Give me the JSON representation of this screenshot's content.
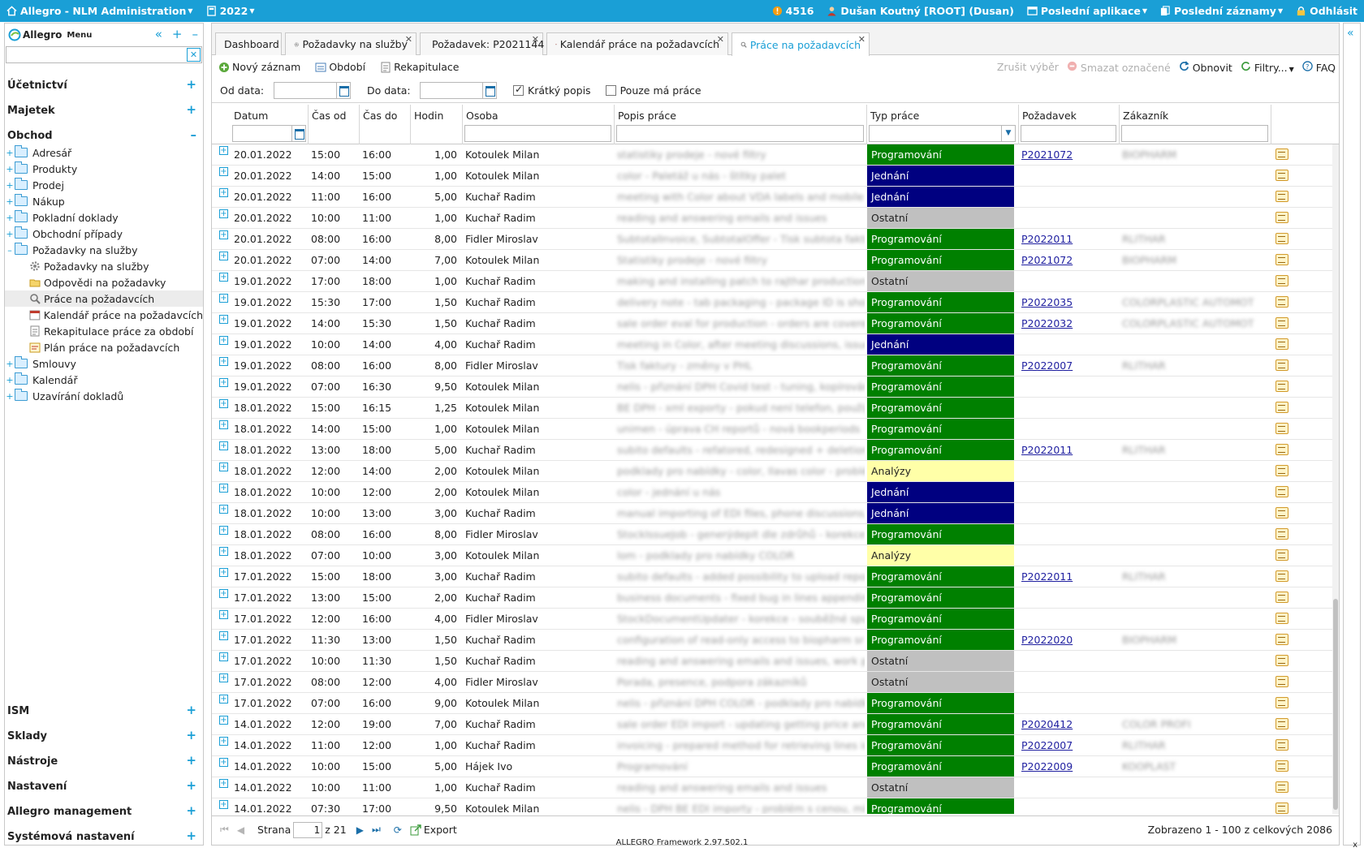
{
  "topbar": {
    "app_title": "Allegro - NLM Administration",
    "year": "2022",
    "count": "4516",
    "user": "Dušan Koutný [ROOT] (Dusan)",
    "recent_apps": "Poslední aplikace",
    "recent_records": "Poslední záznamy",
    "logout": "Odhlásit"
  },
  "sidebar": {
    "logo": "Allegro",
    "menu_label": "Menu",
    "sections_top": [
      {
        "label": "Účetnictví",
        "toggle": "+"
      },
      {
        "label": "Majetek",
        "toggle": "+"
      },
      {
        "label": "Obchod",
        "toggle": "–"
      }
    ],
    "tree": [
      {
        "label": "Adresář",
        "exp": "+"
      },
      {
        "label": "Produkty",
        "exp": "+"
      },
      {
        "label": "Prodej",
        "exp": "+"
      },
      {
        "label": "Nákup",
        "exp": "+"
      },
      {
        "label": "Pokladní doklady",
        "exp": "+"
      },
      {
        "label": "Obchodní případy",
        "exp": "+"
      },
      {
        "label": "Požadavky na služby",
        "exp": "–"
      }
    ],
    "subitems": [
      {
        "label": "Požadavky na služby"
      },
      {
        "label": "Odpovědi na požadavky"
      },
      {
        "label": "Práce na požadavcích"
      },
      {
        "label": "Kalendář práce na požadavcích"
      },
      {
        "label": "Rekapitulace práce za období"
      },
      {
        "label": "Plán práce na požadavcích"
      }
    ],
    "tree_after": [
      {
        "label": "Smlouvy",
        "exp": "+"
      },
      {
        "label": "Kalendář",
        "exp": "+"
      },
      {
        "label": "Uzavírání dokladů",
        "exp": "+"
      }
    ],
    "sections_bottom": [
      {
        "label": "ISM",
        "toggle": "+"
      },
      {
        "label": "Sklady",
        "toggle": "+"
      },
      {
        "label": "Nástroje",
        "toggle": "+"
      },
      {
        "label": "Nastavení",
        "toggle": "+"
      },
      {
        "label": "Allegro management",
        "toggle": "+"
      },
      {
        "label": "Systémová nastavení",
        "toggle": "+"
      }
    ]
  },
  "tabs": [
    {
      "label": "Dashboard"
    },
    {
      "label": "Požadavky na služby"
    },
    {
      "label": "Požadavek: P2021144"
    },
    {
      "label": "Kalendář práce na požadavcích"
    },
    {
      "label": "Práce na požadavcích"
    }
  ],
  "toolbar": {
    "new": "Nový záznam",
    "period": "Období",
    "recap": "Rekapitulace",
    "cancel_selection": "Zrušit výběr",
    "delete_marked": "Smazat označené",
    "refresh": "Obnovit",
    "filters": "Filtry...",
    "faq": "FAQ"
  },
  "filters": {
    "from_label": "Od data:",
    "to_label": "Do data:",
    "short_desc": "Krátký popis",
    "my_work": "Pouze má práce"
  },
  "columns": [
    "Datum",
    "Čas od",
    "Čas do",
    "Hodin",
    "Osoba",
    "Popis práce",
    "Typ práce",
    "Požadavek",
    "Zákazník"
  ],
  "rows": [
    {
      "date": "20.01.2022",
      "from": "15:00",
      "to": "16:00",
      "hours": "1,00",
      "person": "Kotoulek Milan",
      "desc": "statistiky prodeje - nové filtry",
      "type": "Programování",
      "cls": "prog",
      "req": "P2021072",
      "cust": "BIOPHARM"
    },
    {
      "date": "20.01.2022",
      "from": "14:00",
      "to": "15:00",
      "hours": "1,00",
      "person": "Kotoulek Milan",
      "desc": "color - Paletáž u nás - štítky palet",
      "type": "Jednání",
      "cls": "jed",
      "req": "",
      "cust": ""
    },
    {
      "date": "20.01.2022",
      "from": "11:00",
      "to": "16:00",
      "hours": "5,00",
      "person": "Kuchař Radim",
      "desc": "meeting with Color about VDA labels and mobile ap...",
      "type": "Jednání",
      "cls": "jed",
      "req": "",
      "cust": ""
    },
    {
      "date": "20.01.2022",
      "from": "10:00",
      "to": "11:00",
      "hours": "1,00",
      "person": "Kuchař Radim",
      "desc": "reading and answering emails and issues",
      "type": "Ostatní",
      "cls": "ost",
      "req": "",
      "cust": ""
    },
    {
      "date": "20.01.2022",
      "from": "08:00",
      "to": "16:00",
      "hours": "8,00",
      "person": "Fidler Miroslav",
      "desc": "SubtotalInvoice, SubtotalOffer - Tisk subtota faktur...",
      "type": "Programování",
      "cls": "prog",
      "req": "P2022011",
      "cust": "RLITHAR"
    },
    {
      "date": "20.01.2022",
      "from": "07:00",
      "to": "14:00",
      "hours": "7,00",
      "person": "Kotoulek Milan",
      "desc": "Statistiky prodeje - nové filtry",
      "type": "Programování",
      "cls": "prog",
      "req": "P2021072",
      "cust": "BIOPHARM"
    },
    {
      "date": "19.01.2022",
      "from": "17:00",
      "to": "18:00",
      "hours": "1,00",
      "person": "Kuchař Radim",
      "desc": "making and installing patch to rajthar production ser...",
      "type": "Ostatní",
      "cls": "ost",
      "req": "",
      "cust": ""
    },
    {
      "date": "19.01.2022",
      "from": "15:30",
      "to": "17:00",
      "hours": "1,50",
      "person": "Kuchař Radim",
      "desc": "delivery note - tab packaging - package ID is showe...",
      "type": "Programování",
      "cls": "prog",
      "req": "P2022035",
      "cust": "COLORPLASTIC AUTOMOT"
    },
    {
      "date": "19.01.2022",
      "from": "14:00",
      "to": "15:30",
      "hours": "1,50",
      "person": "Kuchař Radim",
      "desc": "sale order eval for production - orders are covered u...",
      "type": "Programování",
      "cls": "prog",
      "req": "P2022032",
      "cust": "COLORPLASTIC AUTOMOT"
    },
    {
      "date": "19.01.2022",
      "from": "10:00",
      "to": "14:00",
      "hours": "4,00",
      "person": "Kuchař Radim",
      "desc": "meeting in Color, after meeting discussions, issues co...",
      "type": "Jednání",
      "cls": "jed",
      "req": "",
      "cust": ""
    },
    {
      "date": "19.01.2022",
      "from": "08:00",
      "to": "16:00",
      "hours": "8,00",
      "person": "Fidler Miroslav",
      "desc": "Tisk faktury - změny v PHL",
      "type": "Programování",
      "cls": "prog",
      "req": "P2022007",
      "cust": "RLITHAR"
    },
    {
      "date": "19.01.2022",
      "from": "07:00",
      "to": "16:30",
      "hours": "9,50",
      "person": "Kotoulek Milan",
      "desc": "nelis - přiznání DPH Covid test - tuning, kopírování,...",
      "type": "Programování",
      "cls": "prog",
      "req": "",
      "cust": ""
    },
    {
      "date": "18.01.2022",
      "from": "15:00",
      "to": "16:15",
      "hours": "1,25",
      "person": "Kotoulek Milan",
      "desc": "BE DPH - xml exporty - pokud není telefon, použije se...",
      "type": "Programování",
      "cls": "prog",
      "req": "",
      "cust": ""
    },
    {
      "date": "18.01.2022",
      "from": "14:00",
      "to": "15:00",
      "hours": "1,00",
      "person": "Kotoulek Milan",
      "desc": "unimen - úprava CH reportů - nová bookperiods",
      "type": "Programování",
      "cls": "prog",
      "req": "",
      "cust": ""
    },
    {
      "date": "18.01.2022",
      "from": "13:00",
      "to": "18:00",
      "hours": "5,00",
      "person": "Kuchař Radim",
      "desc": "subito defaults - refatored, redesigned + deletion of f...",
      "type": "Programování",
      "cls": "prog",
      "req": "P2022011",
      "cust": "RLITHAR"
    },
    {
      "date": "18.01.2022",
      "from": "12:00",
      "to": "14:00",
      "hours": "2,00",
      "person": "Kotoulek Milan",
      "desc": "podklady pro nabídky - color, Ilavas color - problém ...",
      "type": "Analýzy",
      "cls": "ana",
      "req": "",
      "cust": ""
    },
    {
      "date": "18.01.2022",
      "from": "10:00",
      "to": "12:00",
      "hours": "2,00",
      "person": "Kotoulek Milan",
      "desc": "color - jednání u nás",
      "type": "Jednání",
      "cls": "jed",
      "req": "",
      "cust": ""
    },
    {
      "date": "18.01.2022",
      "from": "10:00",
      "to": "13:00",
      "hours": "3,00",
      "person": "Kuchař Radim",
      "desc": "manual importing of EDI files, phone discussions, me...",
      "type": "Jednání",
      "cls": "jed",
      "req": "",
      "cust": ""
    },
    {
      "date": "18.01.2022",
      "from": "08:00",
      "to": "16:00",
      "hours": "8,00",
      "person": "Fidler Miroslav",
      "desc": "StockIssueJob - generýdepit dle zdrůhů - korekce (zh...",
      "type": "Programování",
      "cls": "prog",
      "req": "",
      "cust": ""
    },
    {
      "date": "18.01.2022",
      "from": "07:00",
      "to": "10:00",
      "hours": "3,00",
      "person": "Kotoulek Milan",
      "desc": "lom - podklady pro nabídky COLOR",
      "type": "Analýzy",
      "cls": "ana",
      "req": "",
      "cust": ""
    },
    {
      "date": "17.01.2022",
      "from": "15:00",
      "to": "18:00",
      "hours": "3,00",
      "person": "Kuchař Radim",
      "desc": "subito defaults - added possibility to upload report c...",
      "type": "Programování",
      "cls": "prog",
      "req": "P2022011",
      "cust": "RLITHAR"
    },
    {
      "date": "17.01.2022",
      "from": "13:00",
      "to": "15:00",
      "hours": "2,00",
      "person": "Kuchař Radim",
      "desc": "business documents - fixed bug in lines appending...",
      "type": "Programování",
      "cls": "prog",
      "req": "",
      "cust": ""
    },
    {
      "date": "17.01.2022",
      "from": "12:00",
      "to": "16:00",
      "hours": "4,00",
      "person": "Fidler Miroslav",
      "desc": "StockDocumentUpdater - korekce - souběžné spuštění...",
      "type": "Programování",
      "cls": "prog",
      "req": "",
      "cust": ""
    },
    {
      "date": "17.01.2022",
      "from": "11:30",
      "to": "13:00",
      "hours": "1,50",
      "person": "Kuchař Radim",
      "desc": "configuration of read-only access to biopharm sr sh...",
      "type": "Programování",
      "cls": "prog",
      "req": "P2022020",
      "cust": "BIOPHARM"
    },
    {
      "date": "17.01.2022",
      "from": "10:00",
      "to": "11:30",
      "hours": "1,50",
      "person": "Kuchař Radim",
      "desc": "reading and answering emails and issues, work plan...",
      "type": "Ostatní",
      "cls": "ost",
      "req": "",
      "cust": ""
    },
    {
      "date": "17.01.2022",
      "from": "08:00",
      "to": "12:00",
      "hours": "4,00",
      "person": "Fidler Miroslav",
      "desc": "Porada, presence, podpora zákazníků",
      "type": "Ostatní",
      "cls": "ost",
      "req": "",
      "cust": ""
    },
    {
      "date": "17.01.2022",
      "from": "07:00",
      "to": "16:00",
      "hours": "9,00",
      "person": "Kotoulek Milan",
      "desc": "nelis - přiznání DPH COLOR - podklady pro nabídky...",
      "type": "Programování",
      "cls": "prog",
      "req": "",
      "cust": ""
    },
    {
      "date": "14.01.2022",
      "from": "12:00",
      "to": "19:00",
      "hours": "7,00",
      "person": "Kuchař Radim",
      "desc": "sale order EDI import - updating getting price and c...",
      "type": "Programování",
      "cls": "prog",
      "req": "P2020412",
      "cust": "COLOR PROFI"
    },
    {
      "date": "14.01.2022",
      "from": "11:00",
      "to": "12:00",
      "hours": "1,00",
      "person": "Kuchař Radim",
      "desc": "invoicing - prepared method for retrieving lines ide t...",
      "type": "Programování",
      "cls": "prog",
      "req": "P2022007",
      "cust": "RLITHAR"
    },
    {
      "date": "14.01.2022",
      "from": "10:00",
      "to": "15:00",
      "hours": "5,00",
      "person": "Hájek Ivo",
      "desc": "Programování",
      "type": "Programování",
      "cls": "prog",
      "req": "P2022009",
      "cust": "KOOPLAST"
    },
    {
      "date": "14.01.2022",
      "from": "10:00",
      "to": "11:00",
      "hours": "1,00",
      "person": "Kuchař Radim",
      "desc": "reading and answering emails and issues",
      "type": "Ostatní",
      "cls": "ost",
      "req": "",
      "cust": ""
    },
    {
      "date": "14.01.2022",
      "from": "07:30",
      "to": "17:00",
      "hours": "9,50",
      "person": "Kotoulek Milan",
      "desc": "nelis - DPH BE EDI importy - problém s cenou, mínou...",
      "type": "Programování",
      "cls": "prog",
      "req": "",
      "cust": ""
    }
  ],
  "pager": {
    "page_label": "Strana",
    "page": "1",
    "of_label": "z 21",
    "export": "Export",
    "summary": "Zobrazeno 1 - 100 z celkových 2086"
  },
  "footer": {
    "text": "ALLEGRO Framework 2.97.502.1",
    "close": "x"
  }
}
